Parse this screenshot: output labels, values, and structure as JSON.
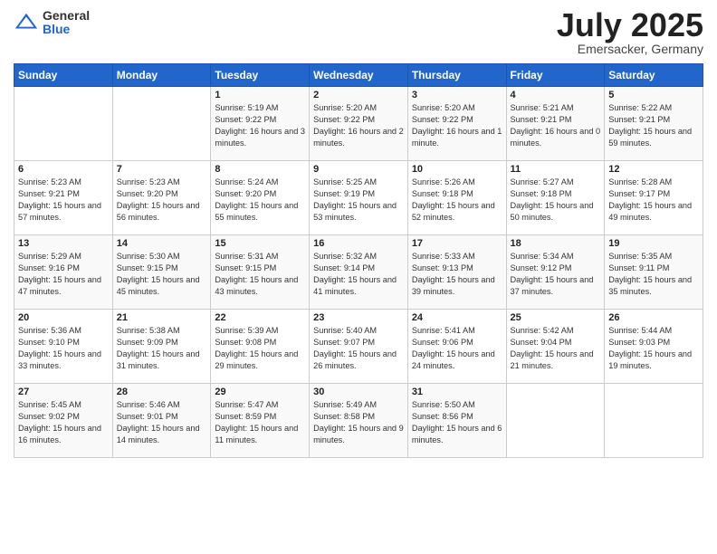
{
  "header": {
    "logo_general": "General",
    "logo_blue": "Blue",
    "month_title": "July 2025",
    "location": "Emersacker, Germany"
  },
  "days_of_week": [
    "Sunday",
    "Monday",
    "Tuesday",
    "Wednesday",
    "Thursday",
    "Friday",
    "Saturday"
  ],
  "weeks": [
    [
      {
        "day": "",
        "sunrise": "",
        "sunset": "",
        "daylight": ""
      },
      {
        "day": "",
        "sunrise": "",
        "sunset": "",
        "daylight": ""
      },
      {
        "day": "1",
        "sunrise": "Sunrise: 5:19 AM",
        "sunset": "Sunset: 9:22 PM",
        "daylight": "Daylight: 16 hours and 3 minutes."
      },
      {
        "day": "2",
        "sunrise": "Sunrise: 5:20 AM",
        "sunset": "Sunset: 9:22 PM",
        "daylight": "Daylight: 16 hours and 2 minutes."
      },
      {
        "day": "3",
        "sunrise": "Sunrise: 5:20 AM",
        "sunset": "Sunset: 9:22 PM",
        "daylight": "Daylight: 16 hours and 1 minute."
      },
      {
        "day": "4",
        "sunrise": "Sunrise: 5:21 AM",
        "sunset": "Sunset: 9:21 PM",
        "daylight": "Daylight: 16 hours and 0 minutes."
      },
      {
        "day": "5",
        "sunrise": "Sunrise: 5:22 AM",
        "sunset": "Sunset: 9:21 PM",
        "daylight": "Daylight: 15 hours and 59 minutes."
      }
    ],
    [
      {
        "day": "6",
        "sunrise": "Sunrise: 5:23 AM",
        "sunset": "Sunset: 9:21 PM",
        "daylight": "Daylight: 15 hours and 57 minutes."
      },
      {
        "day": "7",
        "sunrise": "Sunrise: 5:23 AM",
        "sunset": "Sunset: 9:20 PM",
        "daylight": "Daylight: 15 hours and 56 minutes."
      },
      {
        "day": "8",
        "sunrise": "Sunrise: 5:24 AM",
        "sunset": "Sunset: 9:20 PM",
        "daylight": "Daylight: 15 hours and 55 minutes."
      },
      {
        "day": "9",
        "sunrise": "Sunrise: 5:25 AM",
        "sunset": "Sunset: 9:19 PM",
        "daylight": "Daylight: 15 hours and 53 minutes."
      },
      {
        "day": "10",
        "sunrise": "Sunrise: 5:26 AM",
        "sunset": "Sunset: 9:18 PM",
        "daylight": "Daylight: 15 hours and 52 minutes."
      },
      {
        "day": "11",
        "sunrise": "Sunrise: 5:27 AM",
        "sunset": "Sunset: 9:18 PM",
        "daylight": "Daylight: 15 hours and 50 minutes."
      },
      {
        "day": "12",
        "sunrise": "Sunrise: 5:28 AM",
        "sunset": "Sunset: 9:17 PM",
        "daylight": "Daylight: 15 hours and 49 minutes."
      }
    ],
    [
      {
        "day": "13",
        "sunrise": "Sunrise: 5:29 AM",
        "sunset": "Sunset: 9:16 PM",
        "daylight": "Daylight: 15 hours and 47 minutes."
      },
      {
        "day": "14",
        "sunrise": "Sunrise: 5:30 AM",
        "sunset": "Sunset: 9:15 PM",
        "daylight": "Daylight: 15 hours and 45 minutes."
      },
      {
        "day": "15",
        "sunrise": "Sunrise: 5:31 AM",
        "sunset": "Sunset: 9:15 PM",
        "daylight": "Daylight: 15 hours and 43 minutes."
      },
      {
        "day": "16",
        "sunrise": "Sunrise: 5:32 AM",
        "sunset": "Sunset: 9:14 PM",
        "daylight": "Daylight: 15 hours and 41 minutes."
      },
      {
        "day": "17",
        "sunrise": "Sunrise: 5:33 AM",
        "sunset": "Sunset: 9:13 PM",
        "daylight": "Daylight: 15 hours and 39 minutes."
      },
      {
        "day": "18",
        "sunrise": "Sunrise: 5:34 AM",
        "sunset": "Sunset: 9:12 PM",
        "daylight": "Daylight: 15 hours and 37 minutes."
      },
      {
        "day": "19",
        "sunrise": "Sunrise: 5:35 AM",
        "sunset": "Sunset: 9:11 PM",
        "daylight": "Daylight: 15 hours and 35 minutes."
      }
    ],
    [
      {
        "day": "20",
        "sunrise": "Sunrise: 5:36 AM",
        "sunset": "Sunset: 9:10 PM",
        "daylight": "Daylight: 15 hours and 33 minutes."
      },
      {
        "day": "21",
        "sunrise": "Sunrise: 5:38 AM",
        "sunset": "Sunset: 9:09 PM",
        "daylight": "Daylight: 15 hours and 31 minutes."
      },
      {
        "day": "22",
        "sunrise": "Sunrise: 5:39 AM",
        "sunset": "Sunset: 9:08 PM",
        "daylight": "Daylight: 15 hours and 29 minutes."
      },
      {
        "day": "23",
        "sunrise": "Sunrise: 5:40 AM",
        "sunset": "Sunset: 9:07 PM",
        "daylight": "Daylight: 15 hours and 26 minutes."
      },
      {
        "day": "24",
        "sunrise": "Sunrise: 5:41 AM",
        "sunset": "Sunset: 9:06 PM",
        "daylight": "Daylight: 15 hours and 24 minutes."
      },
      {
        "day": "25",
        "sunrise": "Sunrise: 5:42 AM",
        "sunset": "Sunset: 9:04 PM",
        "daylight": "Daylight: 15 hours and 21 minutes."
      },
      {
        "day": "26",
        "sunrise": "Sunrise: 5:44 AM",
        "sunset": "Sunset: 9:03 PM",
        "daylight": "Daylight: 15 hours and 19 minutes."
      }
    ],
    [
      {
        "day": "27",
        "sunrise": "Sunrise: 5:45 AM",
        "sunset": "Sunset: 9:02 PM",
        "daylight": "Daylight: 15 hours and 16 minutes."
      },
      {
        "day": "28",
        "sunrise": "Sunrise: 5:46 AM",
        "sunset": "Sunset: 9:01 PM",
        "daylight": "Daylight: 15 hours and 14 minutes."
      },
      {
        "day": "29",
        "sunrise": "Sunrise: 5:47 AM",
        "sunset": "Sunset: 8:59 PM",
        "daylight": "Daylight: 15 hours and 11 minutes."
      },
      {
        "day": "30",
        "sunrise": "Sunrise: 5:49 AM",
        "sunset": "Sunset: 8:58 PM",
        "daylight": "Daylight: 15 hours and 9 minutes."
      },
      {
        "day": "31",
        "sunrise": "Sunrise: 5:50 AM",
        "sunset": "Sunset: 8:56 PM",
        "daylight": "Daylight: 15 hours and 6 minutes."
      },
      {
        "day": "",
        "sunrise": "",
        "sunset": "",
        "daylight": ""
      },
      {
        "day": "",
        "sunrise": "",
        "sunset": "",
        "daylight": ""
      }
    ]
  ]
}
